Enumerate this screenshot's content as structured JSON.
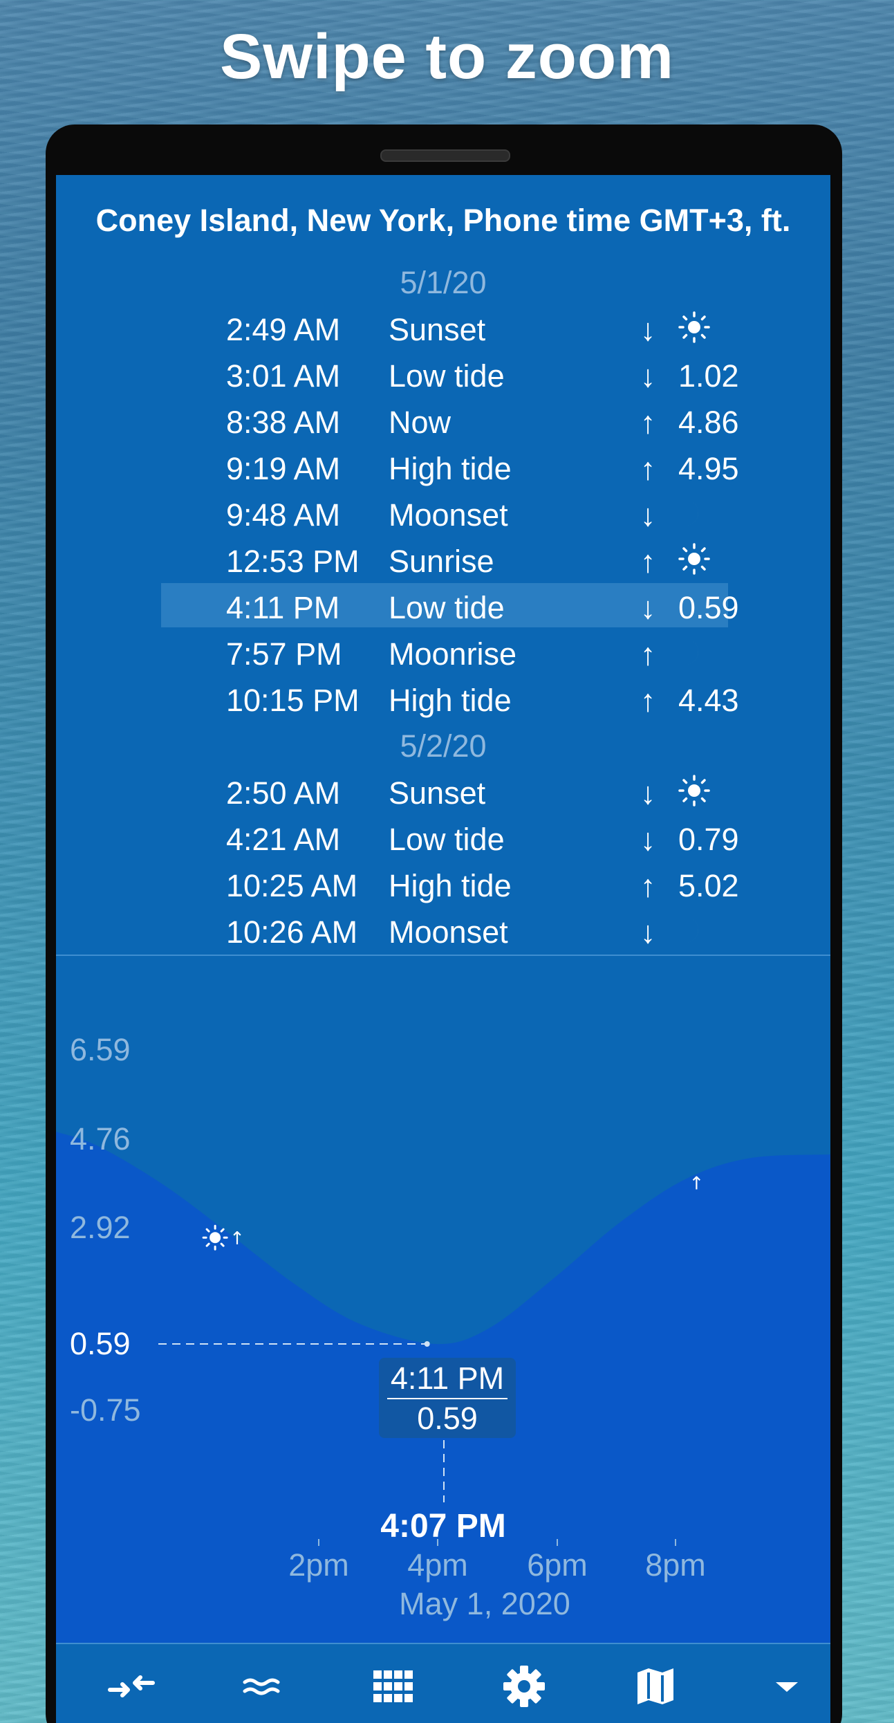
{
  "headline": "Swipe to zoom",
  "location_title": "Coney Island, New York, Phone time GMT+3, ft.",
  "days": [
    {
      "date": "5/1/20",
      "events": [
        {
          "time": "2:49 AM",
          "event": "Sunset",
          "dir": "↓",
          "value": "",
          "icon": "sun-icon"
        },
        {
          "time": "3:01 AM",
          "event": "Low tide",
          "dir": "↓",
          "value": "1.02",
          "icon": ""
        },
        {
          "time": "8:38 AM",
          "event": "Now",
          "dir": "↑",
          "value": "4.86",
          "icon": ""
        },
        {
          "time": "9:19 AM",
          "event": "High tide",
          "dir": "↑",
          "value": "4.95",
          "icon": ""
        },
        {
          "time": "9:48 AM",
          "event": "Moonset",
          "dir": "↓",
          "value": "",
          "icon": "moon-icon"
        },
        {
          "time": "12:53 PM",
          "event": "Sunrise",
          "dir": "↑",
          "value": "",
          "icon": "sun-icon"
        },
        {
          "time": "4:11 PM",
          "event": "Low tide",
          "dir": "↓",
          "value": "0.59",
          "icon": "",
          "selected": true
        },
        {
          "time": "7:57 PM",
          "event": "Moonrise",
          "dir": "↑",
          "value": "",
          "icon": "moon-icon"
        },
        {
          "time": "10:15 PM",
          "event": "High tide",
          "dir": "↑",
          "value": "4.43",
          "icon": ""
        }
      ]
    },
    {
      "date": "5/2/20",
      "events": [
        {
          "time": "2:50 AM",
          "event": "Sunset",
          "dir": "↓",
          "value": "",
          "icon": "sun-icon"
        },
        {
          "time": "4:21 AM",
          "event": "Low tide",
          "dir": "↓",
          "value": "0.79",
          "icon": ""
        },
        {
          "time": "10:25 AM",
          "event": "High tide",
          "dir": "↑",
          "value": "5.02",
          "icon": ""
        },
        {
          "time": "10:26 AM",
          "event": "Moonset",
          "dir": "↓",
          "value": "",
          "icon": "moon-icon"
        }
      ]
    }
  ],
  "chart": {
    "y_labels": [
      "6.59",
      "4.76",
      "2.92",
      "0.59",
      "-0.75"
    ],
    "current_value_label": "0.59",
    "tooltip_time": "4:11 PM",
    "tooltip_value": "0.59",
    "cursor_time": "4:07 PM",
    "x_ticks": [
      "2pm",
      "4pm",
      "6pm",
      "8pm"
    ],
    "x_date": "May 1, 2020",
    "colors": {
      "background": "#0b67b4",
      "tide_fill": "#0a58c8",
      "muted_text": "#8fb8de",
      "highlight_row": "#2a7ec2",
      "tooltip": "#1157a3"
    },
    "marker_sunrise_arrow": "↑",
    "marker_moonrise_arrow": "↑"
  },
  "chart_data": {
    "type": "area",
    "title": "",
    "xlabel": "May 1, 2020",
    "ylabel": "",
    "x_ticks": [
      "2pm",
      "4pm",
      "6pm",
      "8pm"
    ],
    "y_ticks": [
      -0.75,
      0.59,
      2.92,
      4.76,
      6.59
    ],
    "ylim": [
      -2.5,
      7.5
    ],
    "series": [
      {
        "x_hours": [
          10.35,
          11.0,
          12.0,
          13.0,
          14.0,
          15.0,
          16.18,
          17.0,
          18.0,
          19.0,
          20.0,
          21.0,
          22.25
        ],
        "y": [
          4.9,
          4.6,
          3.8,
          2.8,
          1.8,
          1.0,
          0.59,
          0.9,
          1.9,
          3.0,
          3.9,
          4.35,
          4.43
        ]
      }
    ],
    "annotations": [
      {
        "x_hour": 12.88,
        "label": "Sunrise"
      },
      {
        "x_hour": 19.95,
        "label": "Moonrise"
      },
      {
        "x_hour": 16.18,
        "label": "Low tide 0.59"
      }
    ],
    "grid": false
  },
  "bottom_nav": [
    {
      "name": "compress-icon"
    },
    {
      "name": "waves-icon"
    },
    {
      "name": "grid-icon"
    },
    {
      "name": "gear-icon"
    },
    {
      "name": "map-icon"
    },
    {
      "name": "dropdown-icon"
    }
  ]
}
